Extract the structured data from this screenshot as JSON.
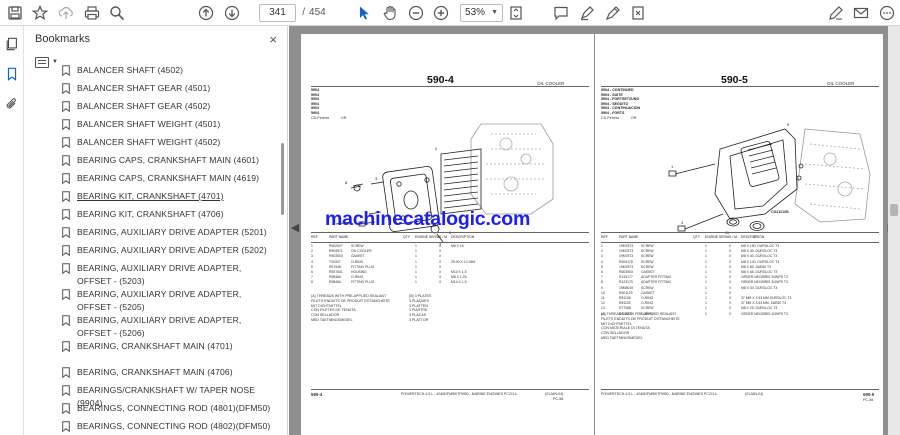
{
  "toolbar": {
    "current_page": "341",
    "page_separator": "/",
    "total_pages": "454",
    "zoom": "53%"
  },
  "bookmarks_panel": {
    "title": "Bookmarks",
    "close": "×",
    "items": [
      {
        "label": "BALANCER SHAFT (4502)"
      },
      {
        "label": "BALANCER SHAFT GEAR (4501)"
      },
      {
        "label": "BALANCER SHAFT GEAR (4502)"
      },
      {
        "label": "BALANCER SHAFT WEIGHT (4501)"
      },
      {
        "label": "BALANCER SHAFT WEIGHT (4502)"
      },
      {
        "label": "BEARING CAPS, CRANKSHAFT MAIN (4601)"
      },
      {
        "label": "BEARING CAPS, CRANKSHAFT MAIN (4619)"
      },
      {
        "label": "BEARING KIT, CRANKSHAFT (4701)"
      },
      {
        "label": "BEARING KIT, CRANKSHAFT (4706)"
      },
      {
        "label": "BEARING, AUXILIARY DRIVE ADAPTER (5201)"
      },
      {
        "label": "BEARING, AUXILIARY DRIVE ADAPTER (5202)"
      },
      {
        "label": "BEARING, AUXILIARY DRIVE ADAPTER, OFFSET - (5203)"
      },
      {
        "label": "BEARING, AUXILIARY DRIVE ADAPTER, OFFSET - (5205)"
      },
      {
        "label": "BEARING, AUXILIARY DRIVE ADAPTER, OFFSET - (5206)"
      },
      {
        "label": "BEARING, CRANKSHAFT MAIN (4701)"
      },
      {
        "label": "BEARING, CRANKSHAFT MAIN (4706)"
      },
      {
        "label": "BEARINGS/CRANKSHAFT W/ TAPER NOSE (9904)"
      },
      {
        "label": "BEARINGS, CONNECTING ROD (4801)(DFM50)"
      },
      {
        "label": "BEARINGS, CONNECTING ROD (4802)(DFM50)"
      }
    ]
  },
  "document": {
    "watermark": "machinecatalogic.com",
    "left_page": {
      "title": "590-4",
      "subtitle": "OIL COOLER",
      "header_lines": [
        "5904",
        "5904",
        "5904",
        "5904",
        "5904",
        "5904"
      ],
      "ref_note": "CD-Pereira",
      "ref_note2": "GR",
      "col_headers": [
        "REF",
        "PART NAME",
        "DESCRIPTION",
        "QTY",
        "ENGINE SERIAL NO.",
        "S / M"
      ],
      "rows": [
        [
          "1",
          "R502527",
          "SCREW",
          "",
          "1",
          "X",
          "M6 X 16"
        ],
        [
          "2",
          "R504971",
          "OIL COOLER",
          "",
          "1",
          "X",
          ""
        ],
        [
          "3",
          "R503503",
          "GASKET",
          "",
          "1",
          "X",
          ""
        ],
        [
          "4",
          "T30307",
          "O-RING",
          "",
          "1",
          "X",
          "25.00 X 2.0 MM"
        ],
        [
          "5",
          "R67546",
          "FITTING PLUG",
          "",
          "1",
          "X",
          ""
        ],
        [
          "6",
          "R507541",
          "HOUSING",
          "",
          "1",
          "X",
          "M10 X 1.5"
        ],
        [
          "7",
          "R58466",
          "O-RING",
          "",
          "1",
          "X",
          "M8 X 1.25"
        ],
        [
          "8",
          "R58466",
          "FITTING PLUG",
          "",
          "1",
          "X",
          "M14 X 1.5"
        ]
      ],
      "notes": [
        "(A) THREADS WITH PRE-APPLIED SEALANT",
        "FILETS ENDUITS DE PRODUIT D'ETANCHEITE",
        "MIT DICHTMITTEL",
        "CON FILETES DE TENUTA",
        "CON SELLADOR",
        "MED TAETNINGSMEDEL"
      ],
      "notes_right": [
        "(B) 3 PLATES",
        "3 PLAQUES",
        "3 PLATTEN",
        "3 PIASTRE",
        "3 PLACAS",
        "3 PLATTOR"
      ],
      "footer_left": "590-4",
      "footer_center": "POWERTECH 4.5 L - 4045DFM50/TFM50 - MARINE ENGINES   PC2114",
      "footer_right": "(01JAN-04)",
      "footer_right2": "PC-56"
    },
    "right_page": {
      "title": "590-5",
      "subtitle": "OIL COOLER",
      "header_lines": [
        "5904 - CONTINUED",
        "5904 - SUITE",
        "5904 - FORTSETZUNG",
        "5904 - SEGUITO",
        "5904 - CONTINUACION",
        "5904 - FORTS"
      ],
      "ref_note": "CD-Pereira",
      "ref_note2": "GR",
      "diagram_label": "CD41016B",
      "col_headers": [
        "REF",
        "PART NAME",
        "DESCRIPTION",
        "QTY",
        "ENGINE SERIAL NO.",
        "S / M"
      ],
      "rows": [
        [
          "1",
          "19M7873",
          "SCREW",
          "",
          "1",
          "X",
          "M8 X 150, DURGLOC T3"
        ],
        [
          "2",
          "19M7873",
          "SCREW",
          "",
          "1",
          "X",
          "M8 X 40, DURGLOC T3"
        ],
        [
          "3",
          "19M7873",
          "SCREW",
          "",
          "1",
          "X",
          "M8 X 40, DURGLOC T3"
        ],
        [
          "4",
          "R504178",
          "SCREW",
          "",
          "1",
          "X",
          "M8 X 100, DURGLOC T3"
        ],
        [
          "5",
          "19M7873",
          "SCREW",
          "",
          "1",
          "X",
          "M8 X 80, SAE60 T3"
        ],
        [
          "6",
          "R503503",
          "GASKET",
          "",
          "1",
          "X",
          "M8 X 65, DURGLOC T3"
        ],
        [
          "7",
          "R133177",
          "ADAPTER FITTING",
          "",
          "1",
          "X",
          "ORDER NEO/BRIS 3/4NPS T3"
        ],
        [
          "8",
          "R123179",
          "ADAPTER FITTING",
          "",
          "1",
          "X",
          "ORDER NEO/BRIS 3/4NPS T3"
        ],
        [
          "9",
          "19M8019",
          "SCREW",
          "",
          "1",
          "X",
          "M8 X 30, DURGLOC T3"
        ],
        [
          "10",
          "R501129",
          "GASKET",
          "",
          "1",
          "X",
          ""
        ],
        [
          "11",
          "R81106",
          "O-RING",
          "",
          "1",
          "X",
          "37 MM X 3.53 MM DURGLOC T3"
        ],
        [
          "12",
          "R81102",
          "O-RING",
          "",
          "1",
          "X",
          "37 MM X 3.53 MM, SAE60 T3"
        ],
        [
          "13",
          "R77088",
          "SCREW",
          "",
          "1",
          "X",
          "M8 X 25, DURGLOC T3"
        ],
        [
          "14",
          "R110202",
          "O-RING",
          "",
          "1",
          "X",
          "ORDER NEO/BRIS 3/4NPS T3"
        ]
      ],
      "notes": [
        "(A) THREADS WITH PRE-APPLIED SEALANT",
        "FILETS ENDUITS DE PRODUIT D'ETANCHEITE",
        "MIT DICHTMITTEL",
        "CON MATERIALE DI TENUTA",
        "CON SELLADOR",
        "MED TAETNINGSMEDEL"
      ],
      "footer_left": "POWERTECH 4.5 L - 4045DFM50/TFM50 - MARINE ENGINES   PC2114",
      "footer_center": "(01JAN-04)",
      "footer_right": "590-5",
      "footer_right2": "PC-56"
    }
  },
  "icons": {
    "toolbar_left": [
      "save-icon",
      "bookmark-star-icon",
      "upload-icon",
      "print-icon",
      "zoom-search-icon"
    ],
    "toolbar_nav": [
      "page-up-icon",
      "page-down-icon"
    ],
    "toolbar_tools": [
      "select-cursor-icon",
      "hand-icon",
      "zoom-out-icon",
      "zoom-in-icon",
      "fit-page-icon"
    ],
    "toolbar_right": [
      "comment-icon",
      "highlight-icon",
      "draw-icon",
      "erase-icon",
      "share-icon",
      "edit-sign-icon",
      "mail-icon",
      "more-icon"
    ],
    "accent_color": "#1565c0"
  }
}
